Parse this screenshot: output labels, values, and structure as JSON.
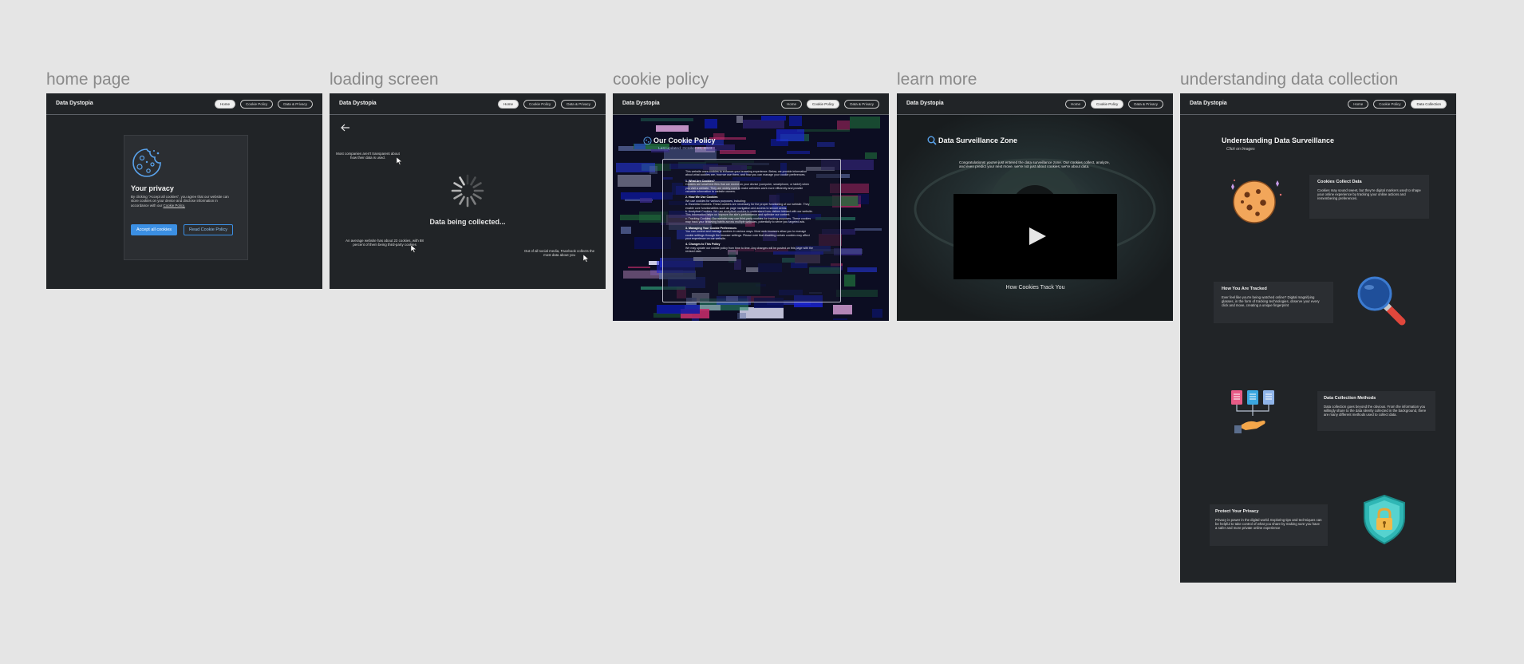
{
  "frames": {
    "home": {
      "label": "home page"
    },
    "loading": {
      "label": "loading screen"
    },
    "cookie": {
      "label": "cookie policy"
    },
    "learn": {
      "label": "learn more"
    },
    "understanding": {
      "label": "understanding data collection"
    }
  },
  "nav": {
    "brand": "Data Dystopia",
    "home": "Home",
    "cookie_policy": "Cookie Policy",
    "data_privacy": "Data & Privacy",
    "data_collection": "Data Collection"
  },
  "home": {
    "title": "Your privacy",
    "body": "By clicking \"Accept all cookies\", you agree that our website can store cookies on your device and disclose information in accordance with our",
    "link": "Cookie Policy.",
    "accept": "Accept all cookies",
    "read": "Read Cookie Policy"
  },
  "loading": {
    "fact1": "Most companies aren't transparent about how their data is used.",
    "status": "Data being collected...",
    "fact2": "An average website has about 23 cookies, with 88 percent of them being third-party cookies",
    "fact3": "Out of all social media, Facebook collects the most data about you"
  },
  "cookie": {
    "title": "Our Cookie Policy",
    "date": "Last updated: October 20, 2023",
    "intro": "This website uses cookies to enhance your browsing experience. Below, we provide information about what cookies are, how we use them, and how you can manage your cookie preferences.",
    "s1": "1. What Are Cookies?",
    "s1_body": "Cookies are small text files that are stored on your device (computer, smartphone, or tablet) when you visit a website. They are widely used to make websites work more efficiently and provide valuable information to website owners.",
    "s2": "2. How We Use Cookies",
    "s2_body": "We use cookies for various purposes, including:",
    "b1": "a. Essential Cookies: These cookies are necessary for the proper functioning of our website. They enable core functionalities such as page navigation and access to secure areas.",
    "b2": "b. Analytical Cookies: We use analytical cookies to understand how visitors interact with our website. This information helps us improve the site's performance and optimize our content.",
    "b3": "c. Tracking Cookies: Our website may use third-party cookies for tracking purposes. These cookies may track your browsing habits across multiple websites, potentially to serve you targeted ads.",
    "s3": "3. Managing Your Cookie Preferences",
    "s3_body": "You can control and manage cookies in various ways. Most web browsers allow you to manage cookie settings through the browser settings. Please note that disabling certain cookies may affect your experience on our website.",
    "s4": "4. Changes to This Policy",
    "s4_body": "We may update our cookie policy from time to time. Any changes will be posted on this page with the revised date."
  },
  "learn": {
    "title": "Data Surveillance Zone",
    "body": "Congratulations! you've just entered the data surveillance zone. Our cookies collect, analyze, and even predict your next move. we're not just about cookies; we're about data.",
    "caption": "How Cookies Track You"
  },
  "understanding": {
    "title": "Understanding Data Surveillance",
    "subtitle": "Click on Images",
    "c1_title": "Cookies Collect Data",
    "c1_body": "Cookies may sound sweet, but they're digital markers used to shape your online experience by tracking your online actions and remembering preferences.",
    "c2_title": "How You Are Tracked",
    "c2_body": "Ever feel like you're being watched online? Digital magnifying glasses, in the form of tracking technologies, observe your every click and move, creating a unique fingerprint",
    "c3_title": "Data Collection Methods",
    "c3_body": "Data collection goes beyond the obvious. From the information you willingly share to the data silently collected in the background, there are many different methods used to collect data.",
    "c4_title": "Protect Your Privacy",
    "c4_body": "Privacy is power in the digital world. Exploring tips and techniques can be helpful to take control of what you share by making sure you have a safer and more private online experience"
  },
  "colors": {
    "canvas": "#e5e5e5",
    "frame": "#212427",
    "accent": "#3b8fe3"
  },
  "icons": [
    "cookie-icon",
    "back-arrow-icon",
    "spinner-icon",
    "cursor-icon",
    "search-icon",
    "play-icon",
    "magnifier-icon",
    "documents-icon",
    "shield-lock-icon"
  ]
}
